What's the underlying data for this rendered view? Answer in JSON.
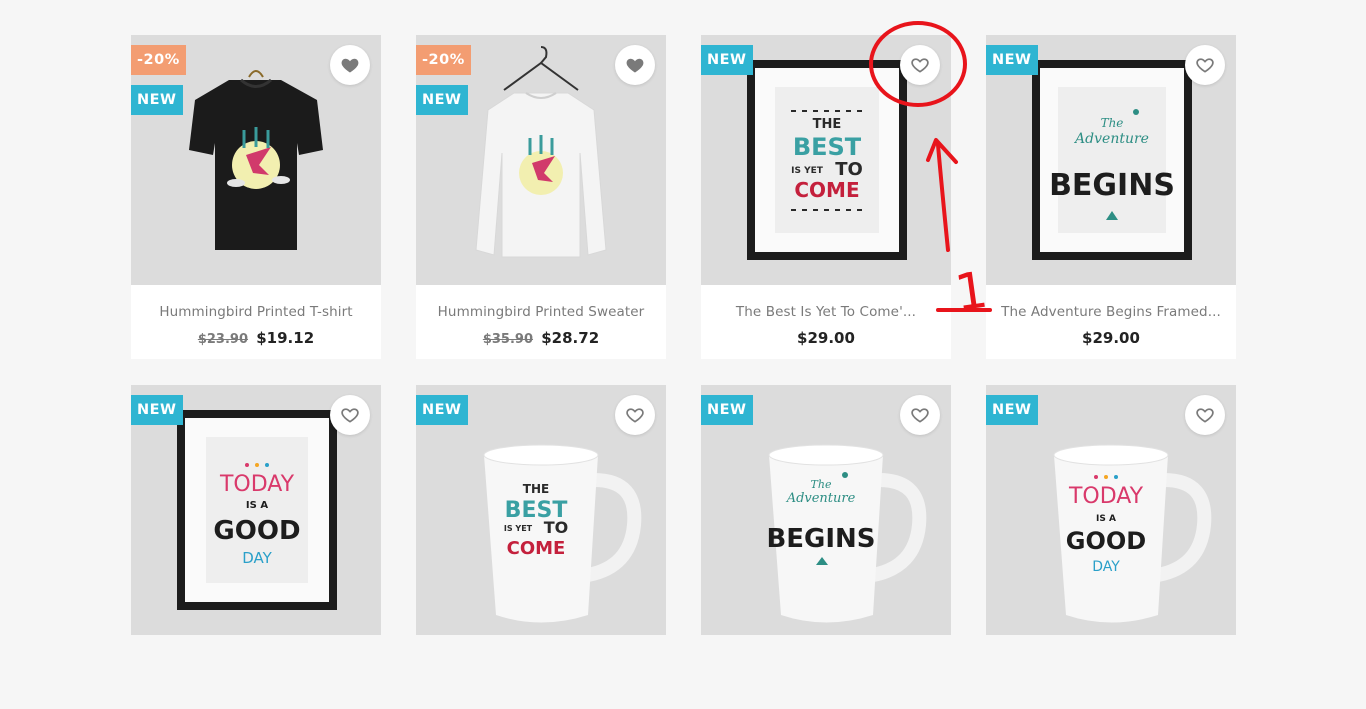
{
  "products": [
    {
      "name": "Hummingbird Printed T-shirt",
      "old_price": "$23.90",
      "price": "$19.12",
      "discount": "-20%",
      "badge": "NEW",
      "wishlisted": true,
      "art": "tshirt-dark"
    },
    {
      "name": "Hummingbird Printed Sweater",
      "old_price": "$35.90",
      "price": "$28.72",
      "discount": "-20%",
      "badge": "NEW",
      "wishlisted": true,
      "art": "sweater-white"
    },
    {
      "name": "The Best Is Yet To Come'...",
      "old_price": "",
      "price": "$29.00",
      "discount": "",
      "badge": "NEW",
      "wishlisted": false,
      "art": "frame-best"
    },
    {
      "name": "The Adventure Begins Framed...",
      "old_price": "",
      "price": "$29.00",
      "discount": "",
      "badge": "NEW",
      "wishlisted": false,
      "art": "frame-adventure"
    },
    {
      "name": "",
      "old_price": "",
      "price": "",
      "discount": "",
      "badge": "NEW",
      "wishlisted": false,
      "art": "frame-today"
    },
    {
      "name": "",
      "old_price": "",
      "price": "",
      "discount": "",
      "badge": "NEW",
      "wishlisted": false,
      "art": "mug-best"
    },
    {
      "name": "",
      "old_price": "",
      "price": "",
      "discount": "",
      "badge": "NEW",
      "wishlisted": false,
      "art": "mug-adventure"
    },
    {
      "name": "",
      "old_price": "",
      "price": "",
      "discount": "",
      "badge": "NEW",
      "wishlisted": false,
      "art": "mug-today"
    }
  ],
  "artwork": {
    "best": {
      "l1": "THE",
      "l2": "BEST",
      "l3": "IS YET",
      "l4": "TO",
      "l5": "COME"
    },
    "adventure": {
      "l1": "The",
      "l2": "Adventure",
      "l3": "BEGINS"
    },
    "today": {
      "l1": "TODAY",
      "l2": "IS A",
      "l3": "GOOD",
      "l4": "DAY"
    }
  },
  "annotation": {
    "label": "1",
    "color": "#e8141b"
  },
  "colors": {
    "new_badge": "#2fb5d2",
    "discount_badge": "#f39d72",
    "background": "#f6f6f6",
    "thumb_bg": "#dcdcdc"
  }
}
